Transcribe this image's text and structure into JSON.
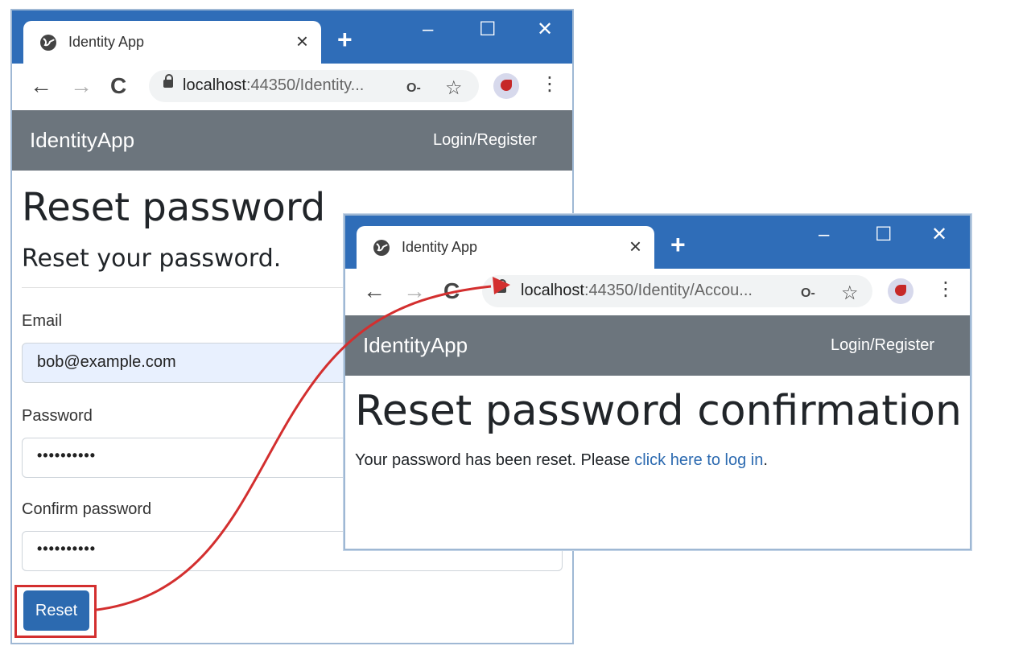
{
  "window1": {
    "tab_title": "Identity App",
    "tab_close": "×",
    "new_tab": "+",
    "controls": {
      "minimize": "–",
      "maximize": "☐",
      "close": "✕"
    },
    "url_host": "localhost",
    "url_path": ":44350/Identity...",
    "nav": {
      "back": "←",
      "forward": "→",
      "reload": "C"
    },
    "brand": "IdentityApp",
    "login_link": "Login/Register",
    "heading": "Reset password",
    "subheading": "Reset your password.",
    "email_label": "Email",
    "email_value": "bob@example.com",
    "password_label": "Password",
    "password_value": "••••••••••",
    "confirm_label": "Confirm password",
    "confirm_value": "••••••••••",
    "reset_button": "Reset"
  },
  "window2": {
    "tab_title": "Identity App",
    "tab_close": "×",
    "new_tab": "+",
    "controls": {
      "minimize": "–",
      "maximize": "☐",
      "close": "✕"
    },
    "url_host": "localhost",
    "url_path": ":44350/Identity/Accou...",
    "nav": {
      "back": "←",
      "forward": "→",
      "reload": "C"
    },
    "brand": "IdentityApp",
    "login_link": "Login/Register",
    "heading": "Reset password confirmation",
    "message_prefix": "Your password has been reset. Please ",
    "message_link": "click here to log in",
    "message_suffix": "."
  },
  "annotation": {
    "color": "#d32f2f"
  }
}
